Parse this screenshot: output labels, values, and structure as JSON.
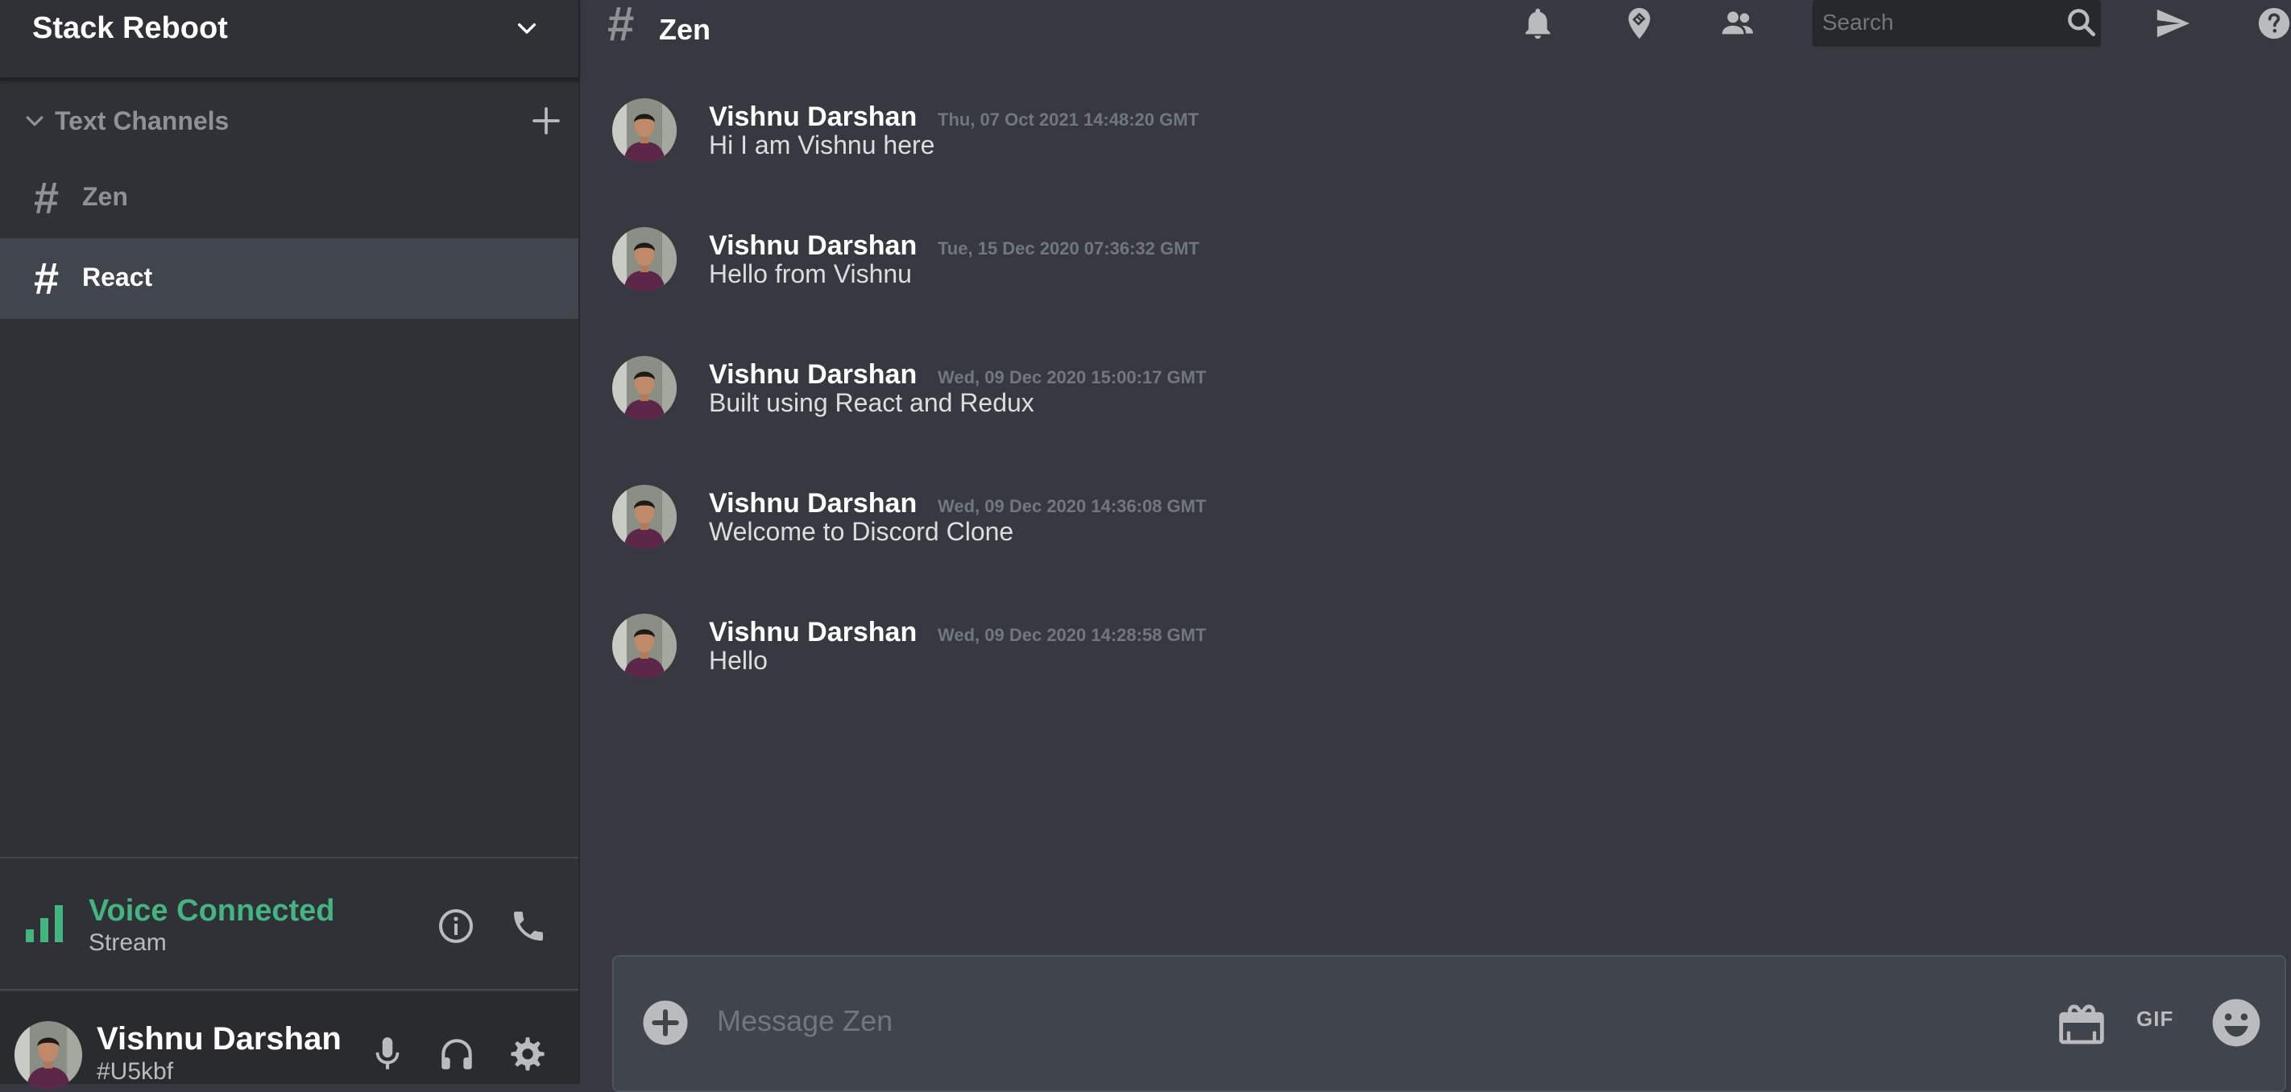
{
  "sidebar": {
    "server_name": "Stack Reboot",
    "channels_header": "Text Channels",
    "channels": [
      {
        "hash": "#",
        "name": "Zen"
      },
      {
        "hash": "#",
        "name": "React"
      }
    ],
    "active_channel": "React",
    "voice": {
      "status": "Voice Connected",
      "sub": "Stream"
    },
    "user": {
      "name": "Vishnu Darshan",
      "tag": "#U5kbf"
    }
  },
  "header": {
    "hash": "#",
    "title": "Zen",
    "search_placeholder": "Search"
  },
  "messages": [
    {
      "author": "Vishnu Darshan",
      "time": "Thu, 07 Oct 2021 14:48:20 GMT",
      "text": "Hi I am Vishnu here"
    },
    {
      "author": "Vishnu Darshan",
      "time": "Tue, 15 Dec 2020 07:36:32 GMT",
      "text": "Hello from Vishnu"
    },
    {
      "author": "Vishnu Darshan",
      "time": "Wed, 09 Dec 2020 15:00:17 GMT",
      "text": "Built using React and Redux"
    },
    {
      "author": "Vishnu Darshan",
      "time": "Wed, 09 Dec 2020 14:36:08 GMT",
      "text": "Welcome to Discord Clone"
    },
    {
      "author": "Vishnu Darshan",
      "time": "Wed, 09 Dec 2020 14:28:58 GMT",
      "text": "Hello"
    }
  ],
  "composer": {
    "placeholder": "Message Zen",
    "gif_label": "GIF"
  },
  "colors": {
    "background": "#36393f",
    "sidebar": "#2f3136",
    "active_channel": "#40464b",
    "voice_green": "#43b581",
    "muted_text": "#8e9297",
    "timestamp": "#72767d"
  },
  "icons": {
    "server_menu": "chevron-down-icon",
    "channels_toggle": "chevron-down-icon",
    "add_channel": "plus-icon",
    "voice_signal": "signal-icon",
    "voice_info": "info-icon",
    "voice_call": "phone-icon",
    "mic": "microphone-icon",
    "headphones": "headphones-icon",
    "settings": "gear-icon",
    "notifications": "bell-icon",
    "pinned": "pin-icon",
    "members": "people-icon",
    "search": "search-icon",
    "send": "send-icon",
    "help": "help-icon",
    "attach": "plus-circle-icon",
    "gift": "gift-icon",
    "emoji": "emoji-icon"
  }
}
